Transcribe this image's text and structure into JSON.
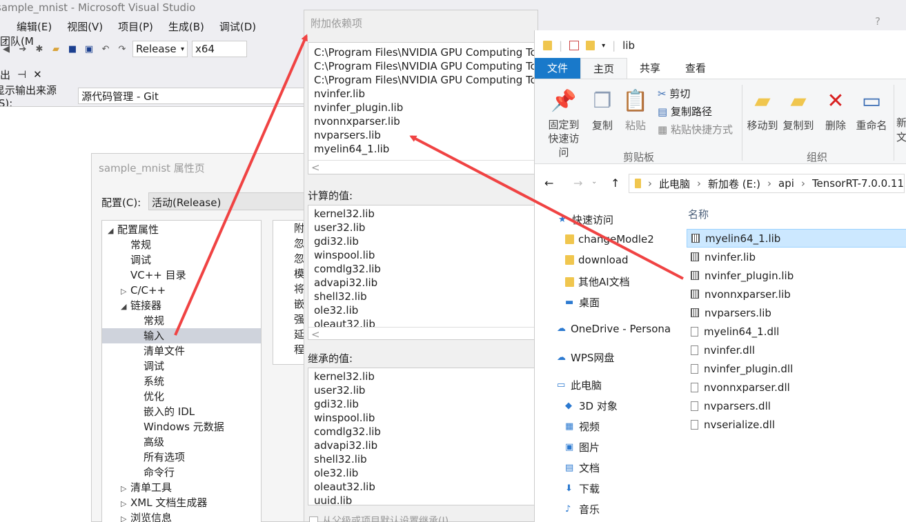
{
  "vs": {
    "title": "sample_mnist - Microsoft Visual Studio",
    "menu": [
      "编辑(E)",
      "视图(V)",
      "项目(P)",
      "生成(B)",
      "调试(D)",
      "团队(M"
    ],
    "config_value": "Release",
    "platform_value": "x64",
    "output_tab_label": "出",
    "output_source_label": "显示输出来源(S):",
    "output_source_value": "源代码管理 - Git"
  },
  "property_page": {
    "title": "sample_mnist 属性页",
    "config_label": "配置(C):",
    "config_value": "活动(Release)",
    "tree": [
      {
        "label": "配置属性",
        "indent": 0,
        "arrow": "◢"
      },
      {
        "label": "常规",
        "indent": 1,
        "arrow": ""
      },
      {
        "label": "调试",
        "indent": 1,
        "arrow": ""
      },
      {
        "label": "VC++ 目录",
        "indent": 1,
        "arrow": ""
      },
      {
        "label": "C/C++",
        "indent": 1,
        "arrow": "▷"
      },
      {
        "label": "链接器",
        "indent": 1,
        "arrow": "◢"
      },
      {
        "label": "常规",
        "indent": 2,
        "arrow": ""
      },
      {
        "label": "输入",
        "indent": 2,
        "arrow": "",
        "selected": true
      },
      {
        "label": "清单文件",
        "indent": 2,
        "arrow": ""
      },
      {
        "label": "调试",
        "indent": 2,
        "arrow": ""
      },
      {
        "label": "系统",
        "indent": 2,
        "arrow": ""
      },
      {
        "label": "优化",
        "indent": 2,
        "arrow": ""
      },
      {
        "label": "嵌入的 IDL",
        "indent": 2,
        "arrow": ""
      },
      {
        "label": "Windows 元数据",
        "indent": 2,
        "arrow": ""
      },
      {
        "label": "高级",
        "indent": 2,
        "arrow": ""
      },
      {
        "label": "所有选项",
        "indent": 2,
        "arrow": ""
      },
      {
        "label": "命令行",
        "indent": 2,
        "arrow": ""
      },
      {
        "label": "清单工具",
        "indent": 1,
        "arrow": "▷"
      },
      {
        "label": "XML 文档生成器",
        "indent": 1,
        "arrow": "▷"
      },
      {
        "label": "浏览信息",
        "indent": 1,
        "arrow": "▷"
      }
    ],
    "right_items": [
      "附",
      "忽",
      "忽",
      "模",
      "将",
      "嵌",
      "强",
      "延",
      "程"
    ]
  },
  "dependency_dialog": {
    "title": "附加依赖项",
    "help": "?",
    "entries": [
      "C:\\Program Files\\NVIDIA GPU Computing Too",
      "C:\\Program Files\\NVIDIA GPU Computing Too",
      "C:\\Program Files\\NVIDIA GPU Computing Too",
      "nvinfer.lib",
      "nvinfer_plugin.lib",
      "nvonnxparser.lib",
      "nvparsers.lib",
      "myelin64_1.lib"
    ],
    "computed_label": "计算的值:",
    "computed": [
      "kernel32.lib",
      "user32.lib",
      "gdi32.lib",
      "winspool.lib",
      "comdlg32.lib",
      "advapi32.lib",
      "shell32.lib",
      "ole32.lib",
      "oleaut32.lib"
    ],
    "inherited_label": "继承的值:",
    "inherited": [
      "kernel32.lib",
      "user32.lib",
      "gdi32.lib",
      "winspool.lib",
      "comdlg32.lib",
      "advapi32.lib",
      "shell32.lib",
      "ole32.lib",
      "oleaut32.lib",
      "uuid.lib"
    ],
    "inherit_checkbox_label": "从父级或项目默认设置继承(I)"
  },
  "explorer": {
    "title": "lib",
    "tabs": [
      "文件",
      "主页",
      "共享",
      "查看"
    ],
    "ribbon": {
      "pin": "固定到\n快速访问",
      "copy": "复制",
      "paste": "粘贴",
      "cut": "剪切",
      "copy_path": "复制路径",
      "paste_shortcut": "粘贴快捷方式",
      "clipboard_group": "剪贴板",
      "move_to": "移动到",
      "copy_to": "复制到",
      "delete": "删除",
      "rename": "重命名",
      "new": "新",
      "new_sub": "文",
      "organize_group": "组织"
    },
    "breadcrumb": [
      "此电脑",
      "新加卷 (E:)",
      "api",
      "TensorRT-7.0.0.11"
    ],
    "column_name": "名称",
    "nav": [
      "快速访问",
      "changeModle2",
      "download",
      "其他AI文档",
      "桌面",
      "OneDrive - Persona",
      "WPS网盘",
      "此电脑",
      "3D 对象",
      "视频",
      "图片",
      "文档",
      "下载",
      "音乐"
    ],
    "files": [
      {
        "name": "myelin64_1.lib",
        "type": "lib",
        "selected": true
      },
      {
        "name": "nvinfer.lib",
        "type": "lib"
      },
      {
        "name": "nvinfer_plugin.lib",
        "type": "lib"
      },
      {
        "name": "nvonnxparser.lib",
        "type": "lib"
      },
      {
        "name": "nvparsers.lib",
        "type": "lib"
      },
      {
        "name": "myelin64_1.dll",
        "type": "dll"
      },
      {
        "name": "nvinfer.dll",
        "type": "dll"
      },
      {
        "name": "nvinfer_plugin.dll",
        "type": "dll"
      },
      {
        "name": "nvonnxparser.dll",
        "type": "dll"
      },
      {
        "name": "nvparsers.dll",
        "type": "dll"
      },
      {
        "name": "nvserialize.dll",
        "type": "dll"
      }
    ]
  },
  "colors": {
    "arrow": "#f04343",
    "selection": "#cce8ff",
    "file_tab": "#1979ca"
  }
}
